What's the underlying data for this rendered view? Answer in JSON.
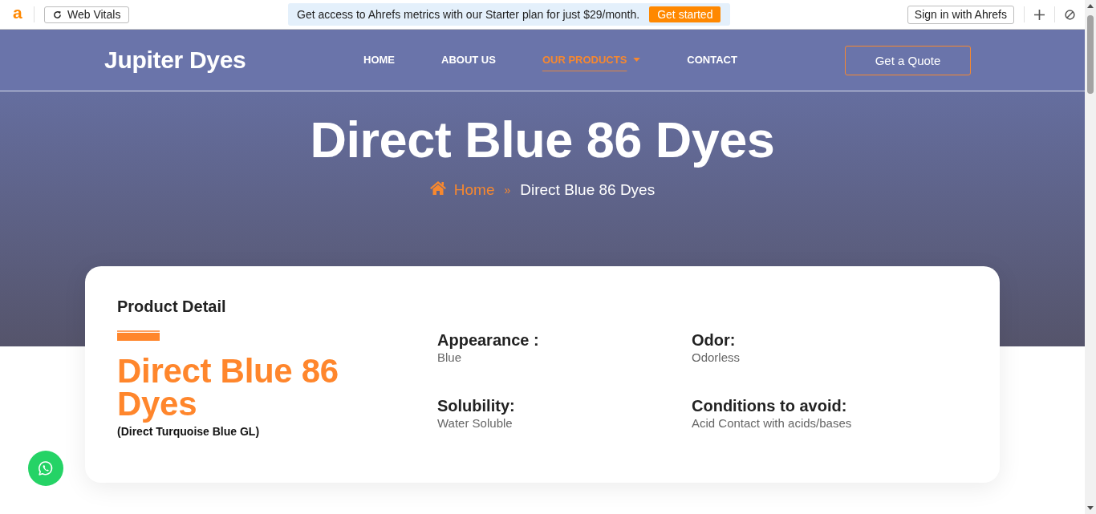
{
  "toolbar": {
    "logo": "a",
    "web_vitals_button": "Web Vitals",
    "promo": {
      "text": "Get access to Ahrefs metrics with our Starter plan for just $29/month.",
      "button": "Get started"
    },
    "sign_in_button": "Sign in with Ahrefs"
  },
  "header": {
    "brand": "Jupiter Dyes",
    "nav": [
      {
        "label": "HOME",
        "selected": false,
        "dropdown": false
      },
      {
        "label": "ABOUT US",
        "selected": false,
        "dropdown": false
      },
      {
        "label": "OUR PRODUCTS",
        "selected": true,
        "dropdown": true
      },
      {
        "label": "CONTACT",
        "selected": false,
        "dropdown": false
      }
    ],
    "quote_button": "Get a Quote"
  },
  "hero": {
    "title": "Direct Blue 86 Dyes",
    "breadcrumb": [
      {
        "kind": "home",
        "label": "Home"
      },
      {
        "kind": "separator",
        "label": "»"
      },
      {
        "kind": "current",
        "label": "Direct Blue 86 Dyes"
      }
    ]
  },
  "product": {
    "heading": "Product Detail",
    "name": "Direct Blue 86 Dyes",
    "subtitle": "(Direct Turquoise Blue GL)",
    "properties": [
      {
        "label": "Appearance :",
        "value": "Blue"
      },
      {
        "label": "Odor:",
        "value": "Odorless"
      },
      {
        "label": "Solubility:",
        "value": "Water Soluble"
      },
      {
        "label": "Conditions to avoid:",
        "value": "Acid Contact with acids/bases"
      }
    ]
  }
}
